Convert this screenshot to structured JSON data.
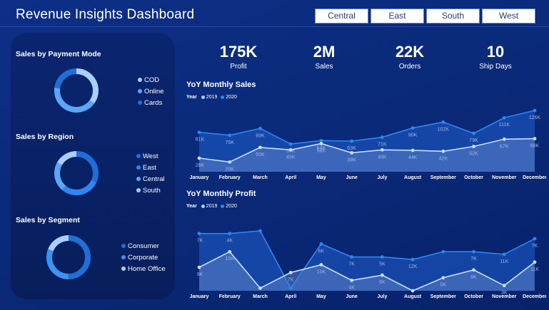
{
  "header": {
    "title": "Revenue Insights Dashboard"
  },
  "filters": [
    "Central",
    "East",
    "South",
    "West"
  ],
  "kpis": [
    {
      "value": "175K",
      "label": "Profit"
    },
    {
      "value": "2M",
      "label": "Sales"
    },
    {
      "value": "22K",
      "label": "Orders"
    },
    {
      "value": "10",
      "label": "Ship Days"
    }
  ],
  "payment_mode": {
    "title": "Sales by Payment Mode",
    "legend": [
      "COD",
      "Online",
      "Cards"
    ],
    "colors": [
      "#a9cffb",
      "#5aa7f7",
      "#1f6fd6"
    ],
    "shares": [
      0.35,
      0.42,
      0.23
    ]
  },
  "region": {
    "title": "Sales by Region",
    "legend": [
      "West",
      "East",
      "Central",
      "South"
    ],
    "colors": [
      "#1f6fd6",
      "#2f86f2",
      "#5aa7f7",
      "#a9cffb"
    ],
    "shares": [
      0.32,
      0.29,
      0.22,
      0.17
    ]
  },
  "segment": {
    "title": "Sales by Segment",
    "legend": [
      "Consumer",
      "Corporate",
      "Home Office"
    ],
    "colors": [
      "#1f6fd6",
      "#3b93f4",
      "#a9cffb"
    ],
    "shares": [
      0.5,
      0.31,
      0.19
    ]
  },
  "chart_data": [
    {
      "type": "area",
      "title": "YoY Monthly Sales",
      "legend_title": "Year",
      "categories": [
        "January",
        "February",
        "March",
        "April",
        "May",
        "June",
        "July",
        "August",
        "September",
        "October",
        "November",
        "December"
      ],
      "series": [
        {
          "name": "2019",
          "color": "#a9cffb",
          "values": [
            28,
            20,
            50,
            45,
            58,
            39,
            45,
            44,
            42,
            52,
            67,
            68
          ],
          "labels": [
            "28K",
            "20K",
            "50K",
            "45K",
            "58K",
            "39K",
            "45K",
            "44K",
            "42K",
            "52K",
            "67K",
            "68K"
          ]
        },
        {
          "name": "2020",
          "color": "#2f86f2",
          "values": [
            81,
            75,
            89,
            57,
            64,
            63,
            71,
            90,
            102,
            79,
            111,
            126
          ],
          "labels": [
            "81K",
            "75K",
            "89K",
            "57K",
            "64K",
            "63K",
            "71K",
            "90K",
            "102K",
            "79K",
            "111K",
            "126K"
          ]
        }
      ]
    },
    {
      "type": "area",
      "title": "YoY Monthly Profit",
      "legend_title": "Year",
      "categories": [
        "January",
        "February",
        "March",
        "April",
        "May",
        "June",
        "July",
        "August",
        "September",
        "October",
        "November",
        "December"
      ],
      "series": [
        {
          "name": "2019",
          "color": "#a9cffb",
          "values": [
            9,
            15,
            1,
            7,
            10,
            4,
            6,
            0,
            5,
            8,
            2,
            11
          ],
          "labels": [
            "9K",
            "15K",
            "",
            "7K",
            "10K",
            "4K",
            "6K",
            "",
            "5K",
            "8K",
            "3K",
            "11K"
          ]
        },
        {
          "name": "2020",
          "color": "#2f86f2",
          "values": [
            22,
            22,
            23,
            1,
            18,
            13,
            13,
            12,
            15,
            15,
            14,
            20
          ],
          "labels": [
            "7K",
            "4K",
            "",
            "",
            "6K",
            "7K",
            "5K",
            "12K",
            "",
            "7K",
            "11K",
            "7K"
          ]
        }
      ]
    }
  ]
}
